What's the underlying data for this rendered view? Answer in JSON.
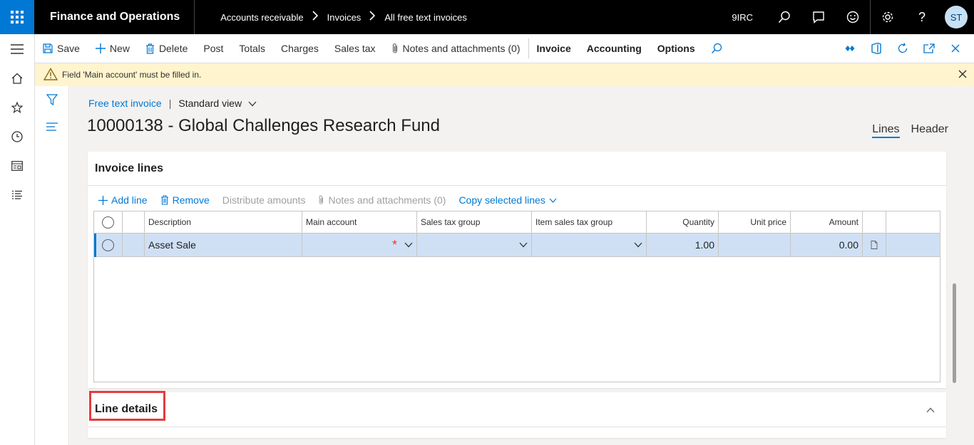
{
  "topbar": {
    "app_title": "Finance and Operations",
    "breadcrumb": [
      "Accounts receivable",
      "Invoices",
      "All free text invoices"
    ],
    "company": "9IRC",
    "user_initials": "ST"
  },
  "actions": {
    "save": "Save",
    "new": "New",
    "delete": "Delete",
    "post": "Post",
    "totals": "Totals",
    "charges": "Charges",
    "sales_tax": "Sales tax",
    "notes": "Notes and attachments (0)",
    "invoice": "Invoice",
    "accounting": "Accounting",
    "options": "Options"
  },
  "message": "Field 'Main account' must be filled in.",
  "page": {
    "form_name": "Free text invoice",
    "view": "Standard view",
    "title": "10000138 - Global Challenges Research Fund",
    "tabs": [
      "Lines",
      "Header"
    ]
  },
  "invoice_lines": {
    "title": "Invoice lines",
    "toolbar": {
      "add_line": "Add line",
      "remove": "Remove",
      "distribute": "Distribute amounts",
      "notes": "Notes and attachments (0)",
      "copy": "Copy selected lines"
    },
    "columns": [
      "Description",
      "Main account",
      "Sales tax group",
      "Item sales tax group",
      "Quantity",
      "Unit price",
      "Amount"
    ],
    "rows": [
      {
        "description": "Asset Sale",
        "main_account": "",
        "sales_tax_group": "",
        "item_sales_tax_group": "",
        "quantity": "1.00",
        "unit_price": "",
        "amount": "0.00"
      }
    ]
  },
  "line_details": {
    "title": "Line details"
  },
  "colors": {
    "accent": "#0078d4",
    "topbar": "#000000",
    "warning_bg": "#fff4ce",
    "required": "#e8393f",
    "selected_row": "#cfe0f5"
  }
}
